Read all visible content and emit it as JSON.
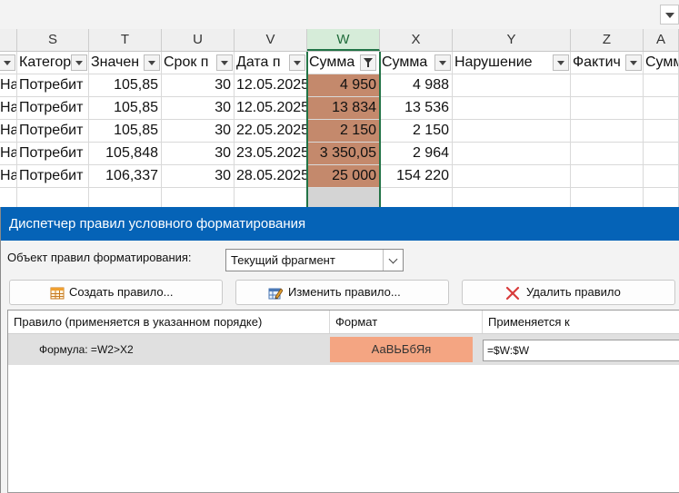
{
  "sheet": {
    "columns": [
      {
        "letter": "",
        "header": "Наимен"
      },
      {
        "letter": "S",
        "header": "Категор"
      },
      {
        "letter": "T",
        "header": "Значен"
      },
      {
        "letter": "U",
        "header": "Срок п"
      },
      {
        "letter": "V",
        "header": "Дата п"
      },
      {
        "letter": "W",
        "header": "Сумма"
      },
      {
        "letter": "X",
        "header": "Сумма"
      },
      {
        "letter": "Y",
        "header": "Нарушение"
      },
      {
        "letter": "Z",
        "header": "Фактич"
      },
      {
        "letter": "A",
        "header": "Сумм"
      }
    ],
    "rows": [
      [
        "Наимен",
        "Потребит",
        "105,85",
        "30",
        "12.05.2025",
        "4 950",
        "4 988",
        "",
        "",
        ""
      ],
      [
        "Наимен",
        "Потребит",
        "105,85",
        "30",
        "12.05.2025",
        "13 834",
        "13 536",
        "",
        "",
        ""
      ],
      [
        "Наимен",
        "Потребит",
        "105,85",
        "30",
        "22.05.2025",
        "2 150",
        "2 150",
        "",
        "",
        ""
      ],
      [
        "Наимен",
        "Потребит",
        "105,848",
        "30",
        "23.05.2025",
        "3 350,05",
        "2 964",
        "",
        "",
        ""
      ],
      [
        "Наимен",
        "Потребит",
        "106,337",
        "30",
        "28.05.2025",
        "25 000",
        "154 220",
        "",
        "",
        ""
      ]
    ],
    "highlight_color": "#c4896c",
    "selected_column": "W"
  },
  "dialog": {
    "title": "Диспетчер правил условного форматирования",
    "scope_label": "Объект правил форматирования:",
    "scope_value": "Текущий фрагмент",
    "buttons": {
      "create": "Создать правило...",
      "edit": "Изменить правило...",
      "delete": "Удалить правило"
    },
    "table_headers": {
      "rule": "Правило (применяется в указанном порядке)",
      "format": "Формат",
      "applies": "Применяется к"
    },
    "rules": [
      {
        "rule": "Формула: =W2>X2",
        "format_preview": "АаВЬБбЯя",
        "applies_to": "=$W:$W",
        "format_color": "#f4a582"
      }
    ]
  }
}
